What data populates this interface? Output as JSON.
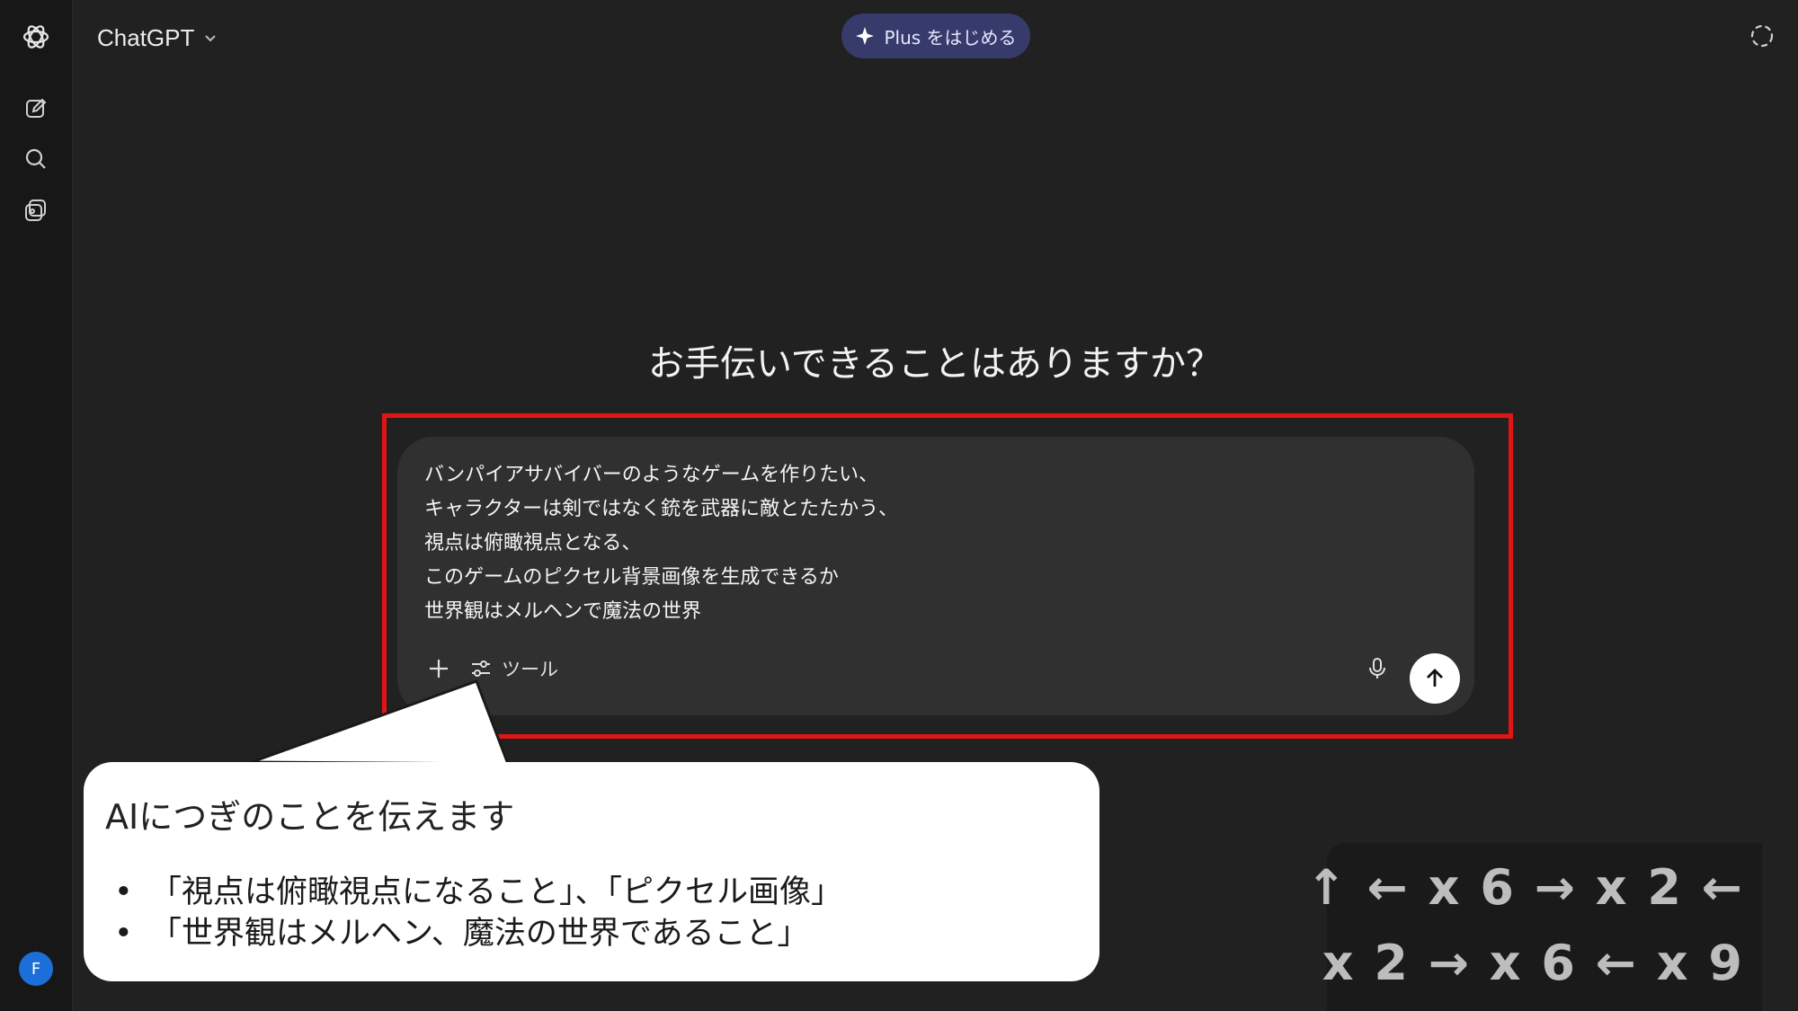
{
  "header": {
    "app_name": "ChatGPT",
    "upgrade_label": "Plus をはじめる"
  },
  "sidebar": {
    "items": [
      {
        "icon": "openai-logo-icon"
      },
      {
        "icon": "new-chat-icon"
      },
      {
        "icon": "search-icon"
      },
      {
        "icon": "library-icon"
      }
    ],
    "avatar_initial": "F"
  },
  "main": {
    "heading": "お手伝いできることはありますか？"
  },
  "composer": {
    "lines": [
      "バンパイアサバイバーのようなゲームを作りたい、",
      "キャラクターは剣ではなく銃を武器に敵とたたかう、",
      "視点は俯瞰視点となる、",
      "このゲームのピクセル背景画像を生成できるか",
      "世界観はメルヘンで魔法の世界"
    ],
    "tools_label": "ツール"
  },
  "callout": {
    "title": "AIにつぎのことを伝えます",
    "bullets": [
      "「視点は俯瞰視点になること」、「ピクセル画像」",
      "「世界観はメルヘン、魔法の世界であること」"
    ]
  },
  "keystrokes": {
    "line1": "↑ ← x 6 → x 2 ←",
    "line2": "x 2 → x 6 ← x 9"
  },
  "colors": {
    "background": "#212121",
    "sidebar": "#171717",
    "composer": "#303030",
    "highlight_border": "#e01515",
    "upgrade_button": "#373b6b",
    "avatar": "#1c6fd8"
  }
}
